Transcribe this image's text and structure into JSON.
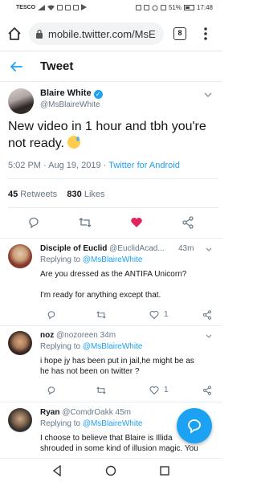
{
  "status_bar": {
    "carrier": "TESCO",
    "battery": "51%",
    "time": "17:48"
  },
  "browser": {
    "url": "mobile.twitter.com/MsE",
    "tab_count": "8"
  },
  "header": {
    "title": "Tweet"
  },
  "tweet": {
    "author_name": "Blaire White",
    "author_handle": "@MsBlaireWhite",
    "text": "New video in 1 hour and tbh you're not ready.",
    "timestamp": "5:02 PM · Aug 19, 2019 · ",
    "source": "Twitter for Android",
    "retweets_count": "45",
    "retweets_label": " Retweets",
    "likes_count": "830",
    "likes_label": " Likes"
  },
  "replies": [
    {
      "name": "Disciple of Euclid",
      "handle": "@EuclidAcad...",
      "time": "43m",
      "replying_prefix": "Replying to ",
      "replying_to": "@MsBlaireWhite",
      "text_lines": [
        "Are you dressed as the ANTIFA Unicorn?",
        "",
        "I'm ready for anything except that."
      ],
      "like_count": "1"
    },
    {
      "name": "noz",
      "handle": "@nozoreen",
      "time": "34m",
      "replying_prefix": "Replying to ",
      "replying_to": "@MsBlaireWhite",
      "text_lines": [
        "i hope jy has been put in jail,he might be as",
        "he has not been on twitter ?"
      ],
      "like_count": "1"
    },
    {
      "name": "Ryan",
      "handle": "@ComdrOakk",
      "time": "45m",
      "replying_prefix": "Replying to ",
      "replying_to": "@MsBlaireWhite",
      "text_lines": [
        "I choose to believe that Blaire is Illida",
        "shrouded in some kind of illusion magic. You"
      ],
      "like_count": ""
    }
  ],
  "colors": {
    "accent": "#1da1f2",
    "like_red": "#e0245e",
    "muted": "#657786"
  }
}
